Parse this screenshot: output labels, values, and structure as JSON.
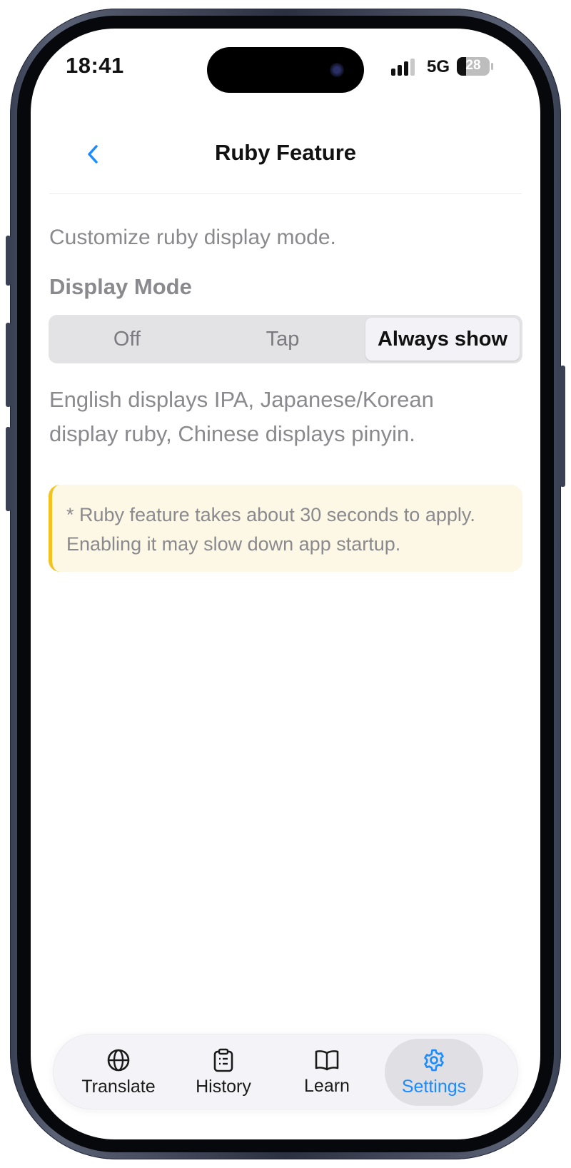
{
  "status_bar": {
    "time": "18:41",
    "network": "5G",
    "battery_percent": "28",
    "battery_level": 0.28
  },
  "nav": {
    "back_icon": "chevron-left-icon",
    "title": "Ruby Feature"
  },
  "content": {
    "intro": "Customize ruby display mode.",
    "section_title": "Display Mode",
    "segments": [
      "Off",
      "Tap",
      "Always show"
    ],
    "selected_segment": "Always show",
    "description": "English displays IPA, Japanese/Korean display ruby, Chinese displays pinyin.",
    "notice_line1": "* Ruby feature takes about 30 seconds to apply.",
    "notice_line2": "Enabling it may slow down app startup."
  },
  "tab_bar": {
    "tabs": [
      {
        "label": "Translate",
        "icon": "globe-icon"
      },
      {
        "label": "History",
        "icon": "clipboard-icon"
      },
      {
        "label": "Learn",
        "icon": "book-icon"
      },
      {
        "label": "Settings",
        "icon": "gear-icon"
      }
    ],
    "active": "Settings"
  },
  "colors": {
    "accent": "#1a8cff",
    "notice_bg": "#fdf7e6",
    "notice_border": "#f4c21c",
    "muted_text": "#8a8a8e"
  }
}
